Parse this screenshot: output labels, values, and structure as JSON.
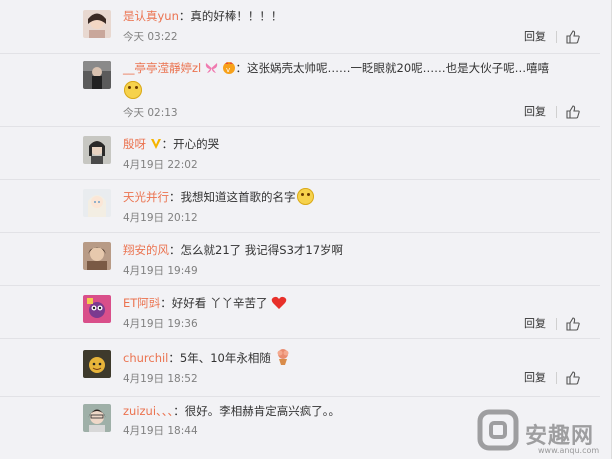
{
  "comments": [
    {
      "user": "是认真yun",
      "text": "真的好棒！！！！",
      "time": "今天 03:22",
      "reply": "回复"
    },
    {
      "user": "__亭亭滢靜婷zl",
      "text": "这张娲壳太帅呢……一眨眼就20呢……也是大伙子呢…嘻嘻",
      "time": "今天 02:13",
      "reply": "回复"
    },
    {
      "user": "殷呀",
      "text": "开心的哭",
      "time": "4月19日 22:02",
      "reply": "回复"
    },
    {
      "user": "天光并行",
      "text": "我想知道这首歌的名字",
      "time": "4月19日 20:12",
      "reply": "回复"
    },
    {
      "user": "翔安的风",
      "text": "怎么就21了 我记得S3才17岁啊",
      "time": "4月19日 19:49",
      "reply": "回复"
    },
    {
      "user": "ET阿㪷",
      "text": "好好看 丫丫辛苦了",
      "time": "4月19日 19:36",
      "reply": "回复"
    },
    {
      "user": "churchil",
      "text": "5年、10年永相随",
      "time": "4月19日 18:52",
      "reply": "回复"
    },
    {
      "user": "zuizui、、、",
      "text": "很好。李相赫肯定高兴疯了。。",
      "time": "4月19日 18:44",
      "reply": "回复"
    }
  ],
  "watermark": {
    "text": "安趣网",
    "url": "www.anqu.com"
  },
  "colors": {
    "username": "#eb7350",
    "time": "#808080",
    "background": "#f2f2f5"
  }
}
